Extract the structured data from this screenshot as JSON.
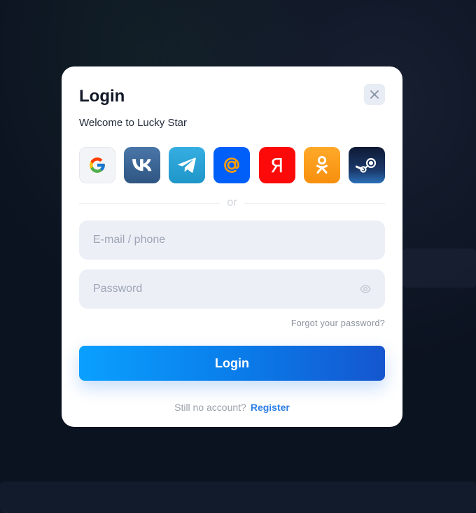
{
  "modal": {
    "title": "Login",
    "subtitle": "Welcome to Lucky Star",
    "close_icon": "close-icon"
  },
  "socials": [
    {
      "id": "google",
      "icon": "google-icon"
    },
    {
      "id": "vk",
      "icon": "vk-icon"
    },
    {
      "id": "telegram",
      "icon": "telegram-icon"
    },
    {
      "id": "mailru",
      "icon": "mailru-at-icon"
    },
    {
      "id": "yandex",
      "icon": "yandex-icon",
      "glyph": "Я"
    },
    {
      "id": "odnoklassniki",
      "icon": "odnoklassniki-icon"
    },
    {
      "id": "steam",
      "icon": "steam-icon"
    }
  ],
  "divider_text": "or",
  "form": {
    "email_placeholder": "E-mail / phone",
    "email_value": "",
    "password_placeholder": "Password",
    "password_value": "",
    "forgot_label": "Forgot your password?",
    "login_label": "Login"
  },
  "register": {
    "prompt": "Still no account?",
    "link_label": "Register"
  },
  "colors": {
    "accent": "#0a7ae8",
    "link": "#2d7fe6",
    "background": "#0b1220"
  }
}
